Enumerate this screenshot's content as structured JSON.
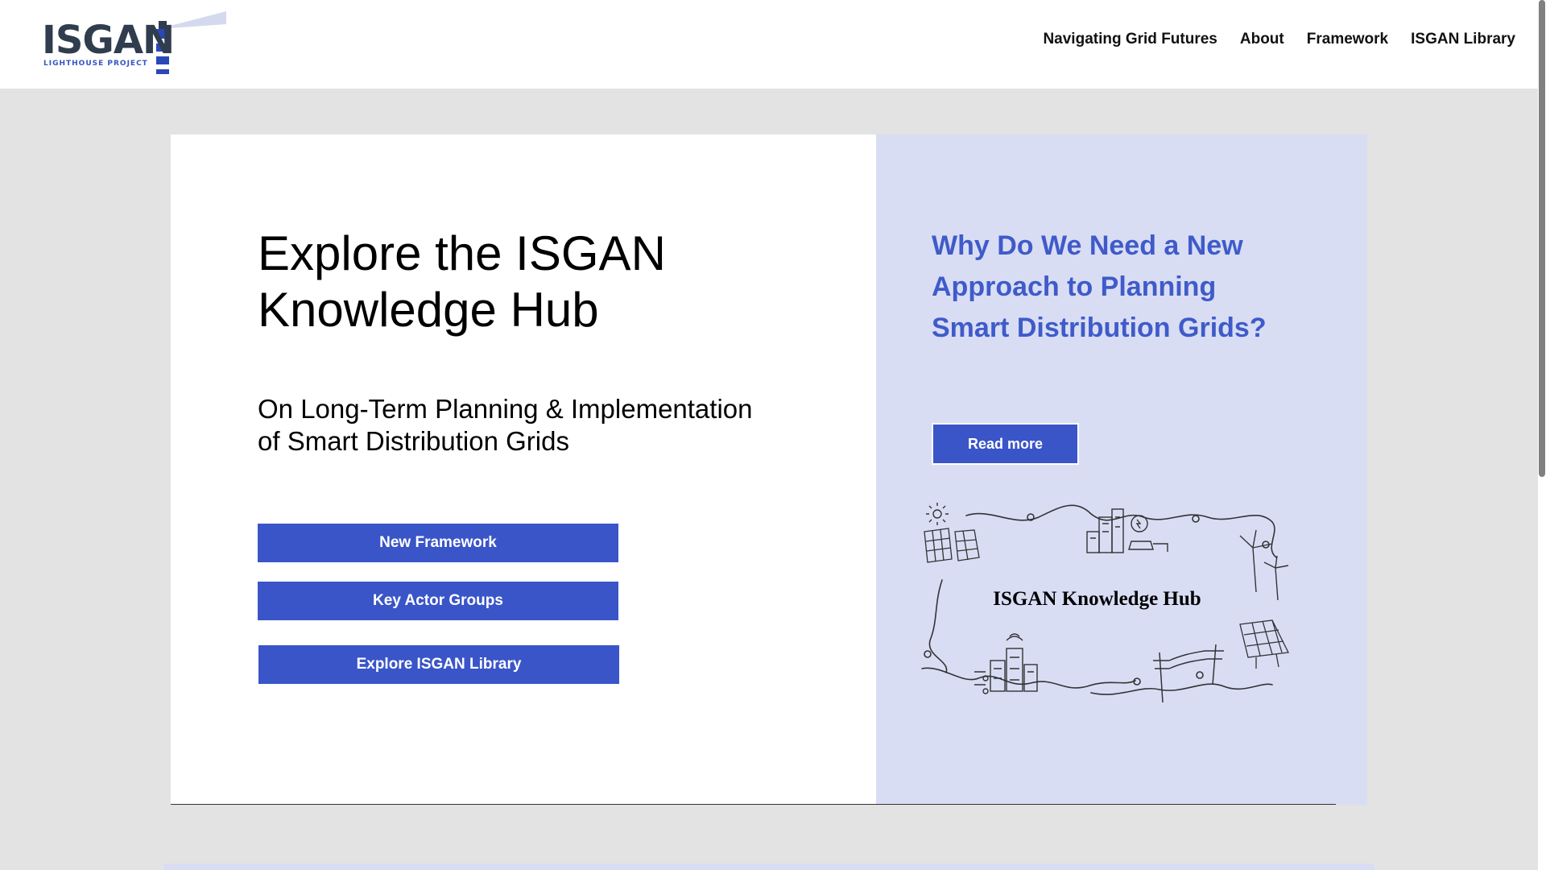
{
  "header": {
    "logo_text": "ISGAN",
    "logo_subtitle": "LIGHTHOUSE PROJECT",
    "nav": [
      {
        "label": "Navigating Grid Futures"
      },
      {
        "label": "About"
      },
      {
        "label": "Framework"
      },
      {
        "label": "ISGAN Library"
      }
    ]
  },
  "hero": {
    "title": "Explore the ISGAN Knowledge Hub",
    "subtitle": "On Long-Term Planning & Implementation of Smart Distribution Grids",
    "buttons": [
      {
        "label": "New Framework"
      },
      {
        "label": "Key Actor Groups"
      },
      {
        "label": "Explore ISGAN Library"
      }
    ]
  },
  "aside": {
    "title": "Why Do We Need a New Approach to Planning Smart Distribution Grids?",
    "read_more": "Read more",
    "illustration_label": "ISGAN Knowledge Hub"
  },
  "colors": {
    "accent": "#3a55c8",
    "heading_blue": "#3f5bc9",
    "panel_lavender": "#d9ddf4",
    "page_bg": "#e3e3e3"
  }
}
